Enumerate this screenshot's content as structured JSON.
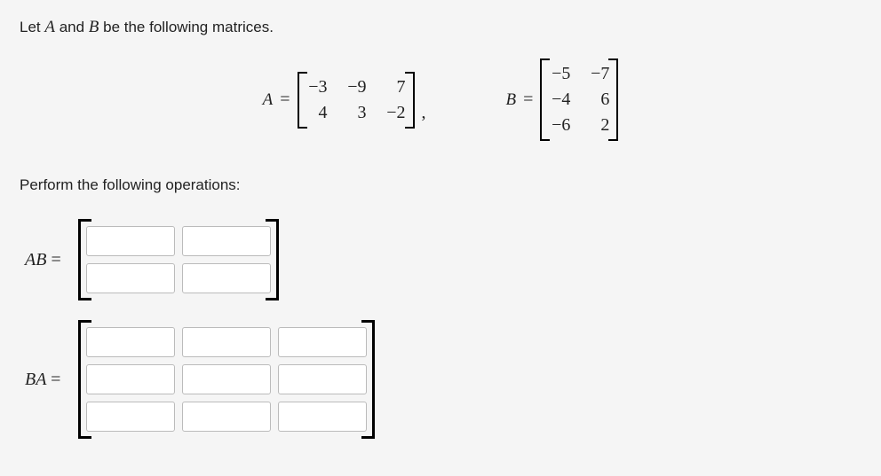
{
  "intro": {
    "prefix": "Let ",
    "var_a": "A",
    "mid": " and ",
    "var_b": "B",
    "suffix": " be the following matrices."
  },
  "matrix_a": {
    "label": "A",
    "eq": "=",
    "cells": [
      "−3",
      "−9",
      "7",
      "4",
      "3",
      "−2"
    ]
  },
  "comma": ",",
  "matrix_b": {
    "label": "B",
    "eq": "=",
    "cells": [
      "−5",
      "−7",
      "−4",
      "6",
      "−6",
      "2"
    ]
  },
  "prompt": "Perform the following operations:",
  "ab": {
    "lhs": "AB",
    "eq": "="
  },
  "ba": {
    "lhs": "BA",
    "eq": "="
  }
}
